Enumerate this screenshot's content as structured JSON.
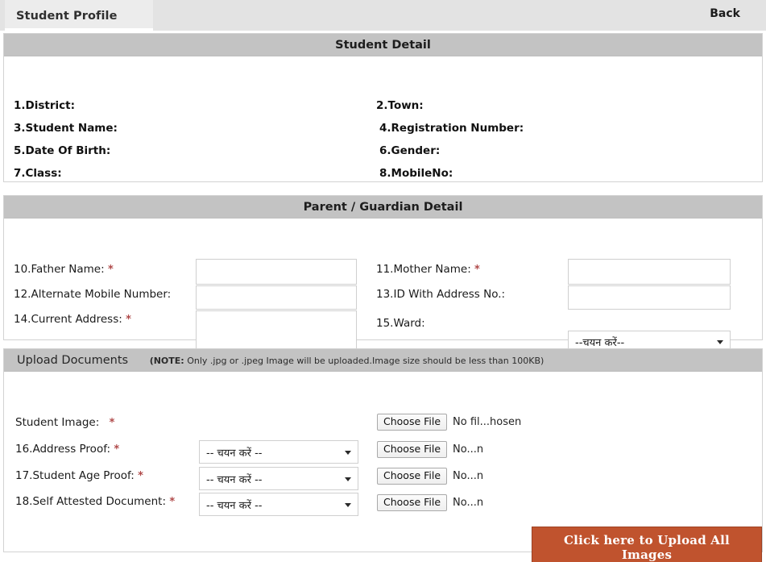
{
  "tab": {
    "label": "Student Profile"
  },
  "back": {
    "label": "Back"
  },
  "student_detail": {
    "header": "Student Detail",
    "fields": [
      {
        "label": "1.District:",
        "value": ""
      },
      {
        "label": "2.Town:",
        "value": ""
      },
      {
        "label": "3.Student Name:",
        "value": ""
      },
      {
        "label": "4.Registration Number:",
        "value": ""
      },
      {
        "label": "5.Date Of Birth:",
        "value": ""
      },
      {
        "label": "6.Gender:",
        "value": ""
      },
      {
        "label": "7.Class:",
        "value": ""
      },
      {
        "label": "8.MobileNo:",
        "value": ""
      }
    ]
  },
  "parent_detail": {
    "header": "Parent / Guardian Detail",
    "father_name": {
      "label": "10.Father Name:",
      "required": "*",
      "value": "",
      "placeholder": ""
    },
    "mother_name": {
      "label": "11.Mother Name:",
      "required": "*",
      "value": "",
      "placeholder": ""
    },
    "alternate_mobile": {
      "label": "12.Alternate Mobile Number:",
      "required": "",
      "value": "",
      "placeholder": ""
    },
    "id_with_address": {
      "label": "13.ID With Address No.:",
      "required": "",
      "value": "",
      "placeholder": ""
    },
    "current_address": {
      "label": "14.Current Address:",
      "required": "*",
      "value": "",
      "placeholder": ""
    },
    "ward": {
      "label": "15.Ward:",
      "required": "",
      "selected": "--चयन करें--",
      "options": [
        "--चयन करें--"
      ]
    }
  },
  "upload": {
    "header": "Upload Documents",
    "note_prefix": "(NOTE:",
    "note_text": " Only .jpg or .jpeg Image will be uploaded.Image size should be less than 100KB)",
    "rows": [
      {
        "label": "Student Image:",
        "required": "*",
        "has_select": false,
        "selected": "",
        "file_button": "Choose File",
        "file_name": "No fil...hosen"
      },
      {
        "label": "16.Address Proof:",
        "required": "*",
        "has_select": true,
        "selected": "-- चयन करें --",
        "file_button": "Choose File",
        "file_name": "No...n"
      },
      {
        "label": "17.Student Age Proof:",
        "required": "*",
        "has_select": true,
        "selected": "-- चयन करें --",
        "file_button": "Choose File",
        "file_name": "No...n"
      },
      {
        "label": "18.Self Attested Document:",
        "required": "*",
        "has_select": true,
        "selected": "-- चयन करें --",
        "file_button": "Choose File",
        "file_name": "No...n"
      }
    ],
    "submit_button": "Click here to Upload All Images"
  },
  "colors": {
    "band": "#c3c3c3",
    "tabbar": "#e3e3e3",
    "required": "#b04a4a",
    "upload_button": "#c0532e"
  }
}
